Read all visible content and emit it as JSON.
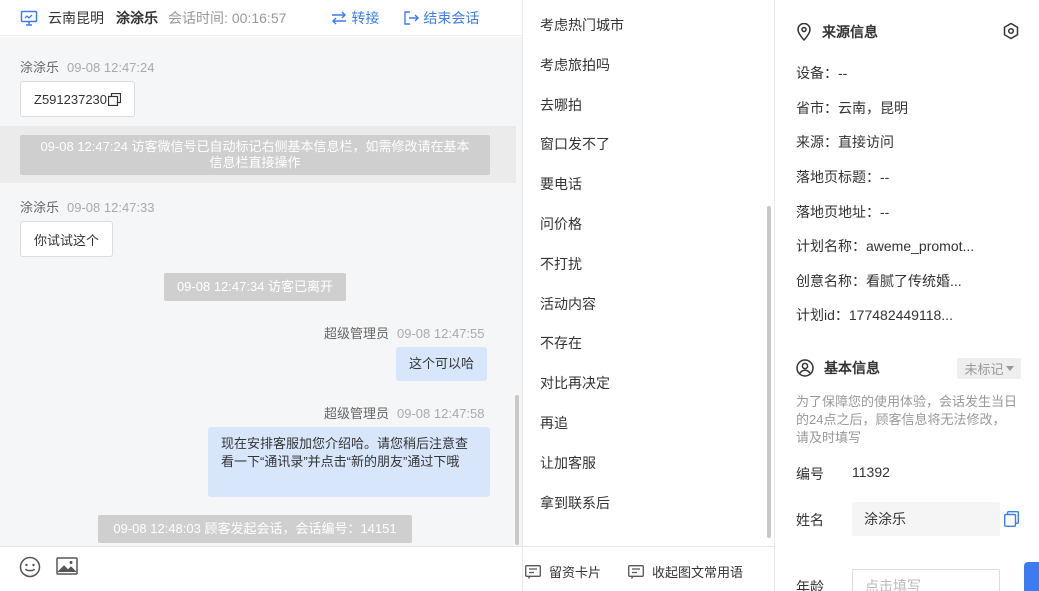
{
  "header": {
    "location": "云南昆明",
    "visitor_name": "涂涂乐",
    "session_label": "会话时间:",
    "session_time": "00:16:57",
    "transfer_label": "转接",
    "end_label": "结束会话"
  },
  "messages": {
    "m1_sender": "涂涂乐",
    "m1_time": "09-08 12:47:24",
    "m1_text": "Z591237230",
    "sys1_text": "09-08 12:47:24 访客微信号已自动标记右侧基本信息栏，如需修改请在基本信息栏直接操作",
    "m2_sender": "涂涂乐",
    "m2_time": "09-08 12:47:33",
    "m2_text": "你试试这个",
    "sys2_text": "09-08 12:47:34 访客已离开",
    "m3_sender": "超级管理员",
    "m3_time": "09-08 12:47:55",
    "m3_text": "这个可以哈",
    "m4_sender": "超级管理员",
    "m4_time": "09-08 12:47:58",
    "m4_text": "现在安排客服加您介绍哈。请您稍后注意查看一下“通讯录”并点击“新的朋友”通过下哦",
    "sys3_text": "09-08 12:48:03 顾客发起会话，会话编号：14151"
  },
  "quick_replies": [
    "考虑热门城市",
    "考虑旅拍吗",
    "去哪拍",
    "窗口发不了",
    "要电话",
    "问价格",
    "不打扰",
    "活动内容",
    "不存在",
    "对比再决定",
    "再追",
    "让加客服",
    "拿到联系后"
  ],
  "quick_toolbar": {
    "card_label": "留资卡片",
    "collapse_label": "收起图文常用语"
  },
  "source_info": {
    "title": "来源信息",
    "rows": [
      "设备：--",
      "省市：云南，昆明",
      "来源：直接访问",
      "落地页标题：--",
      "落地页地址：--",
      "计划名称：aweme_promot...",
      "创意名称：看腻了传统婚...",
      "计划id：177482449118..."
    ]
  },
  "basic_info": {
    "title": "基本信息",
    "tag_label": "未标记",
    "notice": "为了保障您的使用体验，会话发生当日的24点之后，顾客信息将无法修改，请及时填写",
    "id_label": "编号",
    "id_value": "11392",
    "name_label": "姓名",
    "name_value": "涂涂乐",
    "age_label": "年龄",
    "age_placeholder": "点击填写"
  }
}
